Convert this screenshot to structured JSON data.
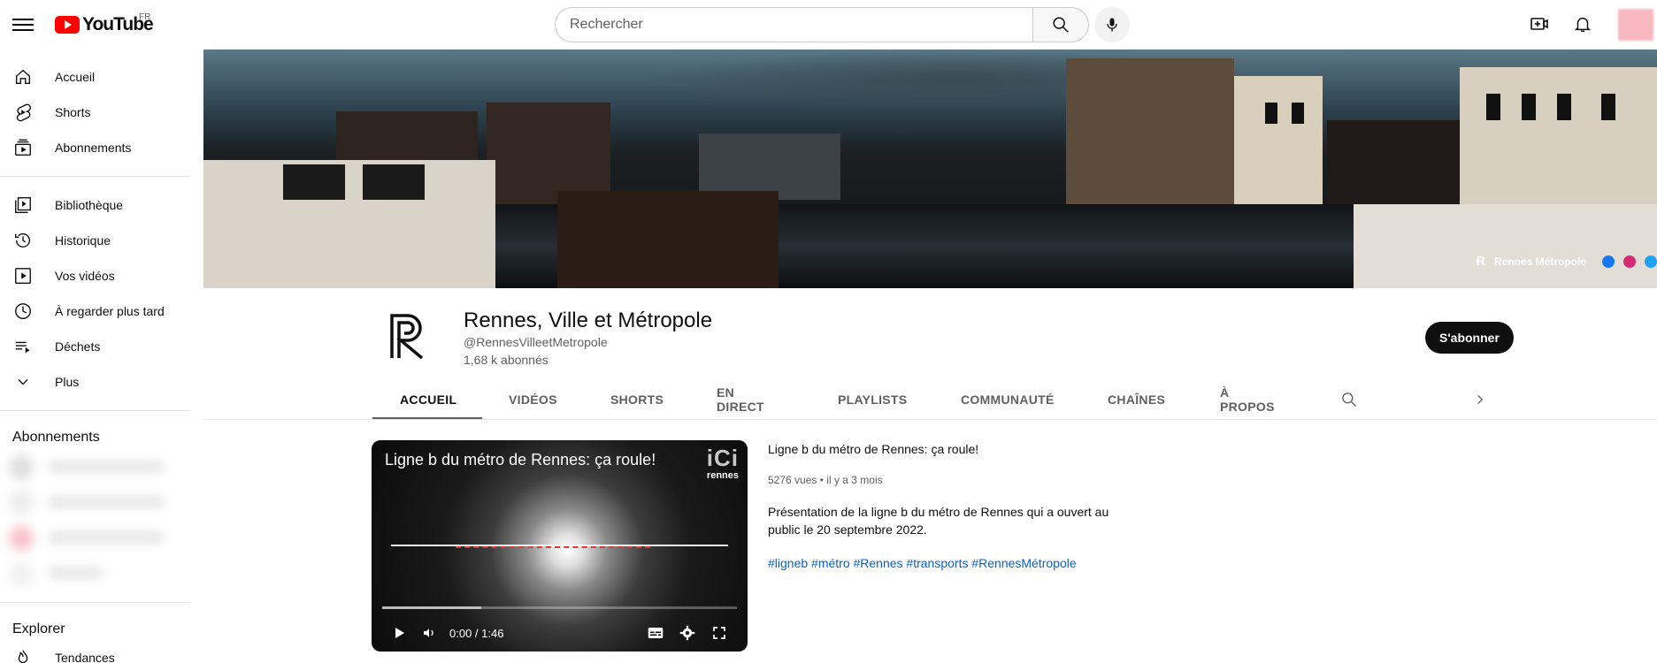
{
  "topbar": {
    "logo_text": "YouTube",
    "region": "FR",
    "search_placeholder": "Rechercher"
  },
  "sidebar": {
    "main": [
      {
        "label": "Accueil",
        "icon": "home-icon"
      },
      {
        "label": "Shorts",
        "icon": "shorts-icon"
      },
      {
        "label": "Abonnements",
        "icon": "subscriptions-icon"
      }
    ],
    "library": [
      {
        "label": "Bibliothèque",
        "icon": "library-icon"
      },
      {
        "label": "Historique",
        "icon": "history-icon"
      },
      {
        "label": "Vos vidéos",
        "icon": "your-videos-icon"
      },
      {
        "label": "À regarder plus tard",
        "icon": "watch-later-icon"
      },
      {
        "label": "Déchets",
        "icon": "playlist-icon"
      },
      {
        "label": "Plus",
        "icon": "chevron-down-icon"
      }
    ],
    "subscriptions_title": "Abonnements",
    "explore_title": "Explorer",
    "explore_first": "Tendances"
  },
  "banner": {
    "brand": "Rennes Métropole"
  },
  "channel": {
    "name": "Rennes, Ville et Métropole",
    "handle": "@RennesVilleetMetropole",
    "subscribers": "1,68 k abonnés",
    "subscribe_label": "S'abonner"
  },
  "tabs": [
    {
      "label": "ACCUEIL",
      "active": true
    },
    {
      "label": "VIDÉOS"
    },
    {
      "label": "SHORTS"
    },
    {
      "label": "EN DIRECT"
    },
    {
      "label": "PLAYLISTS"
    },
    {
      "label": "COMMUNAUTÉ"
    },
    {
      "label": "CHAÎNES"
    },
    {
      "label": "À PROPOS"
    }
  ],
  "video": {
    "overlay_title": "Ligne b du métro de Rennes: ça roule!",
    "watermark_top": "iCi",
    "watermark_bottom": "rennes",
    "time": "0:00 / 1:46",
    "title": "Ligne b du métro de Rennes: ça roule!",
    "views": "5276 vues",
    "age": "il y a 3 mois",
    "description": "Présentation de la ligne b du métro de Rennes qui a ouvert au public le 20 septembre 2022.",
    "hashtags": "#ligneb #métro #Rennes #transports #RennesMétropole"
  },
  "colors": {
    "brand_red": "#ff0000",
    "link_blue": "#065fd4",
    "text_primary": "#0f0f0f",
    "text_secondary": "#606060"
  }
}
